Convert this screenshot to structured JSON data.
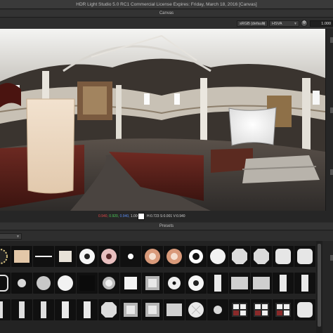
{
  "window": {
    "title": "HDR Light Studio 5.0 RC1 Commercial License Expires: Friday, March 18, 2016  [Canvas]"
  },
  "canvas_panel": {
    "title": "Canvas",
    "colorspace_select": "sRGB (default)",
    "mode_select": "HSVA",
    "exposure_value": "1.000"
  },
  "status": {
    "r": "0.940,",
    "g": "0.920,",
    "b": "0.940,",
    "a": "1.000",
    "hsv": "H:0.723 S:0.001 V:0.940"
  },
  "presets_panel": {
    "title": "Presets"
  },
  "colors": {
    "accent_red": "#e04848",
    "accent_green": "#4ecf5a",
    "accent_blue": "#5b8cf0"
  },
  "preset_tiles": [
    [
      "starburst-icon",
      "softbox-gradient-icon",
      "strip-light-icon",
      "softbox-square-icon",
      "ring-light-icon",
      "radial-eye-icon",
      "sparkle-icon",
      "orange-ring-icon",
      "orange-ring-icon",
      "black-dot-icon",
      "white-disc-icon",
      "octagon-icon",
      "octagon-icon",
      "rounded-square-icon",
      "rounded-square-icon"
    ],
    [
      "rounded-frame-icon",
      "soft-dot-icon",
      "glow-disc-icon",
      "white-disc-icon",
      "dark-tile-icon",
      "spot-glow-icon",
      "square-light-icon",
      "gradient-square-icon",
      "dot-ring-icon",
      "ring-light-icon",
      "tall-rect-icon",
      "gradient-panel-icon",
      "gradient-panel-icon",
      "tall-rect-icon",
      "tall-rect-icon"
    ],
    [
      "bar-light-icon",
      "bar-light-icon",
      "bar-light-icon",
      "tall-rect-icon",
      "tall-rect-icon",
      "octagon-icon",
      "gradient-square-icon",
      "gradient-square-icon",
      "rect-panel-icon",
      "star-disc-icon",
      "soft-dot-icon",
      "window-icon",
      "window-icon",
      "window-icon",
      "rounded-square-icon"
    ]
  ]
}
